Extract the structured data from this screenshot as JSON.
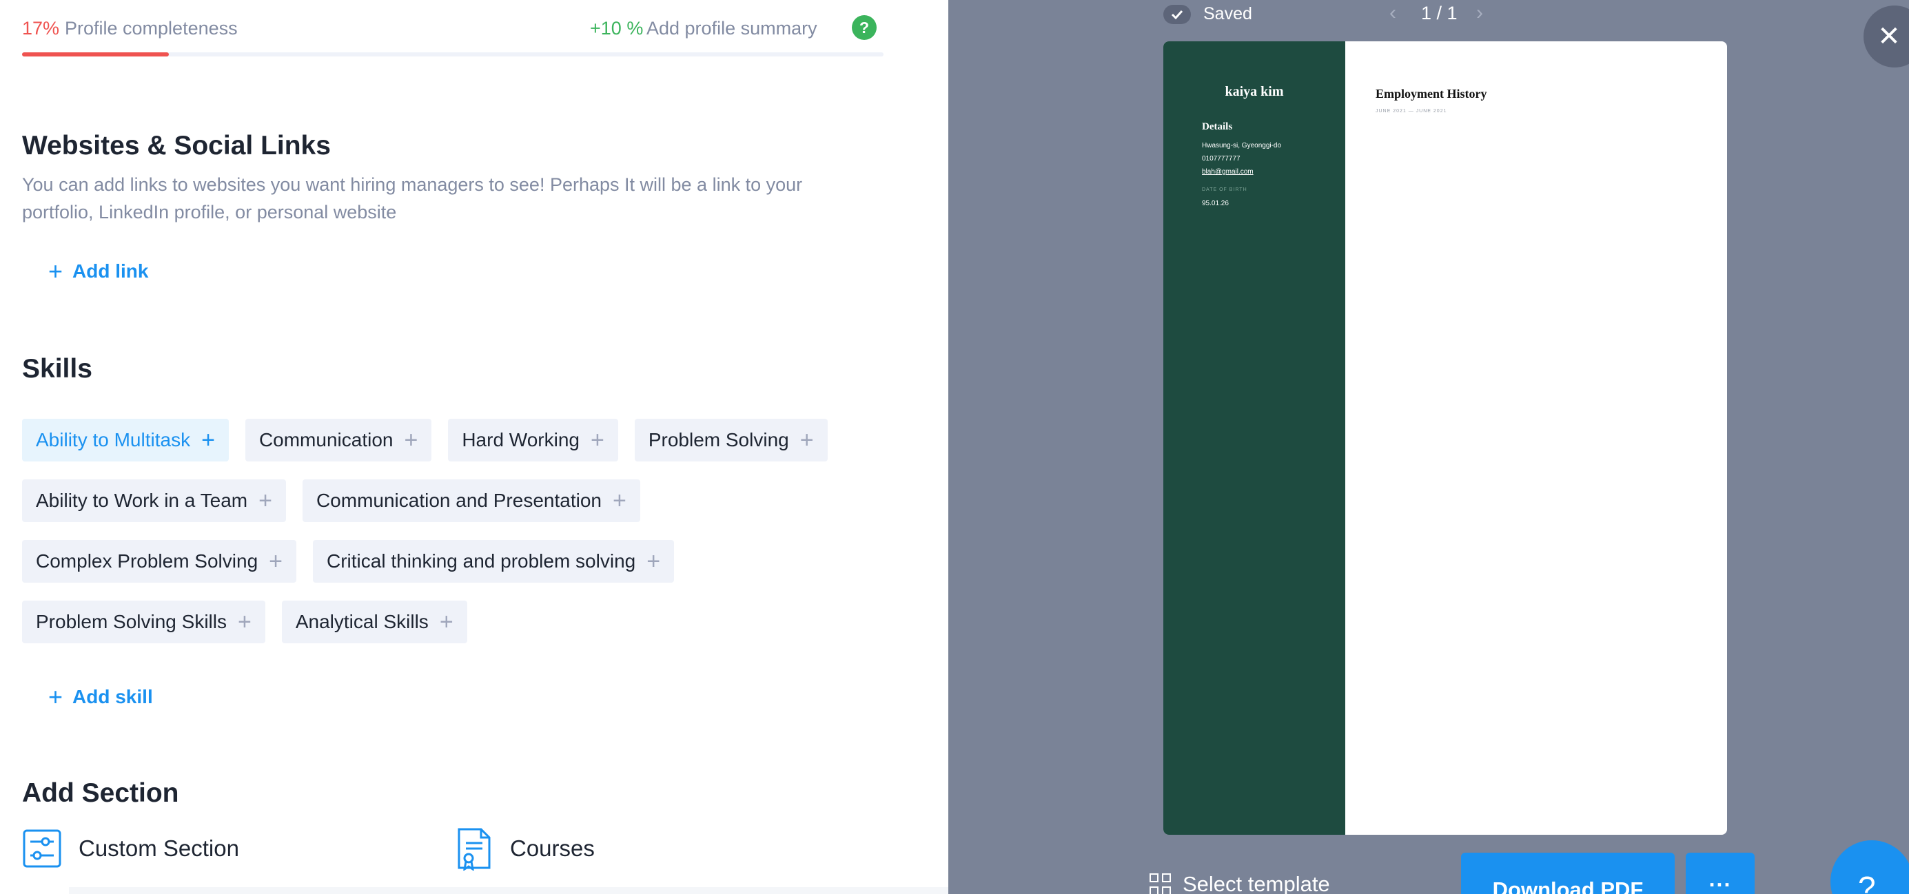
{
  "progress": {
    "percent": "17",
    "percent_unit": "%",
    "label": "Profile completeness",
    "gain": "+10",
    "gain_unit": "%",
    "gain_label": "Add profile summary",
    "help": "?",
    "fill_fraction": 0.17,
    "colors": {
      "percent": "#ef5350",
      "gain": "#3bb45c"
    }
  },
  "websites": {
    "title": "Websites & Social Links",
    "description": "You can add links to websites you want hiring managers to see! Perhaps It will be a link to your portfolio, LinkedIn profile, or personal website",
    "add_label": "Add link"
  },
  "skills": {
    "title": "Skills",
    "rows": [
      [
        {
          "label": "Ability to Multitask",
          "active": true
        },
        {
          "label": "Communication"
        },
        {
          "label": "Hard Working"
        },
        {
          "label": "Problem Solving"
        }
      ],
      [
        {
          "label": "Ability to Work in a Team"
        },
        {
          "label": "Communication and Presentation"
        }
      ],
      [
        {
          "label": "Complex Problem Solving"
        },
        {
          "label": "Critical thinking and problem solving"
        }
      ],
      [
        {
          "label": "Problem Solving Skills"
        },
        {
          "label": "Analytical Skills"
        }
      ]
    ],
    "add_label": "Add skill"
  },
  "add_section": {
    "title": "Add Section",
    "items": [
      {
        "label": "Custom Section",
        "icon": "sliders-icon"
      },
      {
        "label": "Courses",
        "icon": "certificate-document-icon"
      }
    ]
  },
  "preview": {
    "status": "Saved",
    "pager": {
      "current": "1",
      "total": "1",
      "separator": " / "
    },
    "close": "✕",
    "resume": {
      "name": "kaiya kim",
      "details_heading": "Details",
      "address": "Hwasung-si, Gyeonggi-do",
      "phone": "0107777777",
      "email": "blah@gmail.com",
      "dob_label": "DATE OF BIRTH",
      "dob": "95.01.26",
      "employment_heading": "Employment History",
      "employment_dates": "JUNE 2021 — JUNE 2021",
      "sidebar_color": "#1e4b40"
    },
    "select_template": "Select template",
    "download": "Download PDF",
    "more": "...",
    "help": "?"
  },
  "colors": {
    "accent": "#1a91f0",
    "preview_bg": "#7a8397",
    "chip_bg": "#eff2f9"
  }
}
